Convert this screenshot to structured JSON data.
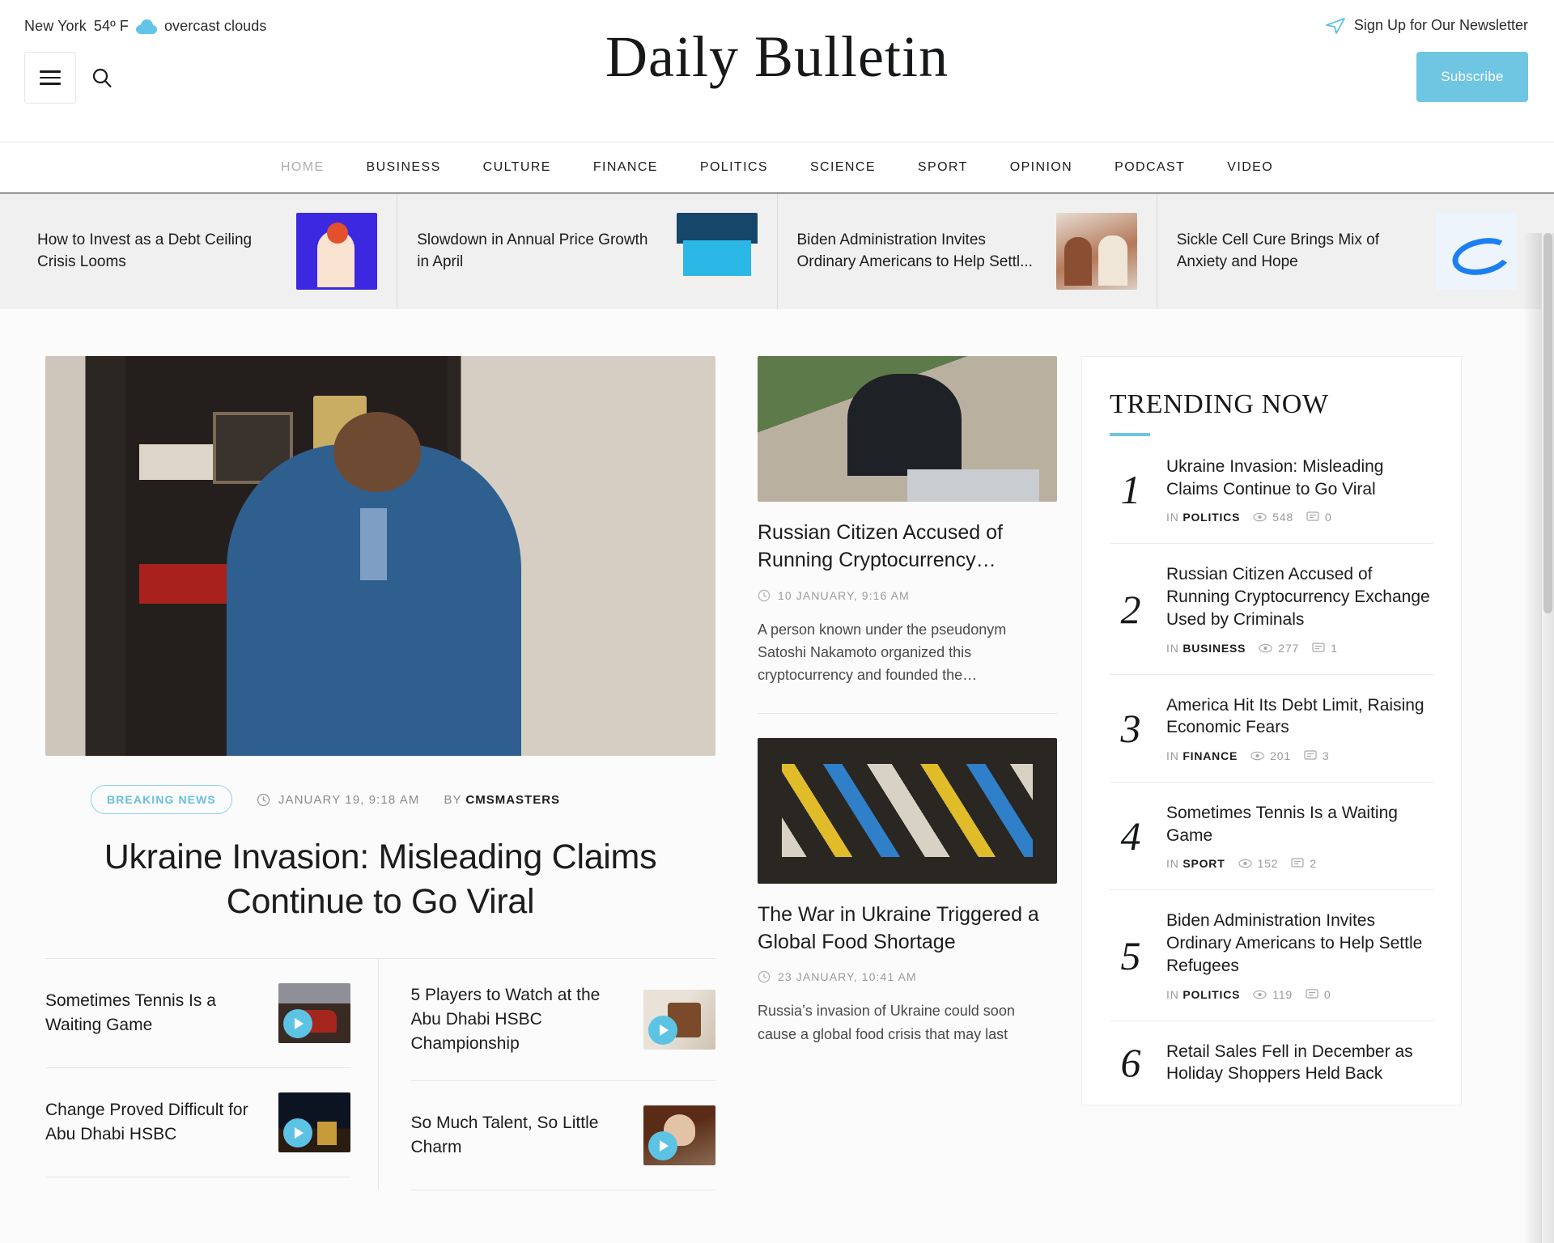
{
  "topbar": {
    "weather": {
      "city": "New York",
      "temp": "54º F",
      "condition": "overcast clouds",
      "icon": "cloud-icon"
    },
    "newsletter_label": "Sign Up for Our Newsletter",
    "newsletter_icon": "paper-plane-icon",
    "subscribe_label": "Subscribe",
    "menu_icon": "hamburger-menu-icon",
    "search_icon": "search-icon",
    "site_title_word1": "Daily",
    "site_title_word2": "Bulletin"
  },
  "nav": {
    "items": [
      {
        "label": "HOME",
        "active": true
      },
      {
        "label": "BUSINESS",
        "active": false
      },
      {
        "label": "CULTURE",
        "active": false
      },
      {
        "label": "FINANCE",
        "active": false
      },
      {
        "label": "POLITICS",
        "active": false
      },
      {
        "label": "SCIENCE",
        "active": false
      },
      {
        "label": "SPORT",
        "active": false
      },
      {
        "label": "OPINION",
        "active": false
      },
      {
        "label": "PODCAST",
        "active": false
      },
      {
        "label": "VIDEO",
        "active": false
      }
    ]
  },
  "ticker": {
    "items": [
      {
        "title": "How to Invest as a Debt Ceiling Crisis Looms",
        "art": "art-invest"
      },
      {
        "title": "Slowdown in Annual Price Growth in April",
        "art": "art-laptop"
      },
      {
        "title": "Biden Administration Invites Ordinary Americans to Help Settl...",
        "art": "art-women"
      },
      {
        "title": "Sickle Cell Cure Brings Mix of Anxiety and Hope",
        "art": "art-meta"
      }
    ]
  },
  "hero": {
    "badge": "BREAKING NEWS",
    "date": "JANUARY 19, 9:18 AM",
    "by_prefix": "BY",
    "author": "CMSMASTERS",
    "title": "Ukraine Invasion: Misleading Claims Continue to Go Viral",
    "clock_icon": "clock-icon"
  },
  "sub_articles": {
    "left": [
      {
        "title": "Sometimes Tennis Is a Waiting Game",
        "art": "th-car",
        "play_icon": "play-icon"
      },
      {
        "title": "Change Proved Difficult for Abu Dhabi HSBC",
        "art": "th-night",
        "play_icon": "play-icon"
      }
    ],
    "right": [
      {
        "title": "5 Players to Watch at the Abu Dhabi HSBC Championship",
        "art": "th-window",
        "play_icon": "play-icon"
      },
      {
        "title": "So Much Talent, So Little Charm",
        "art": "th-portrait",
        "play_icon": "play-icon"
      }
    ]
  },
  "mid_articles": [
    {
      "title": "Russian Citizen Accused of Running Cryptocurrency…",
      "date": "10 JANUARY, 9:16 AM",
      "excerpt": "A person known under the pseudonym Satoshi Nakamoto organized this cryptocurrency and founded the…",
      "art": "mimg-woman",
      "clock_icon": "clock-icon"
    },
    {
      "title": "The War in Ukraine Triggered a Global Food Shortage",
      "date": "23 JANUARY, 10:41 AM",
      "excerpt": "Russia’s invasion of Ukraine could soon cause a global food crisis that may last",
      "art": "mimg-protest",
      "clock_icon": "clock-icon"
    }
  ],
  "trending": {
    "heading": "TRENDING NOW",
    "in_label": "IN",
    "views_icon": "eye-icon",
    "comments_icon": "comment-icon",
    "items": [
      {
        "num": "1",
        "title": "Ukraine Invasion: Misleading Claims Continue to Go Viral",
        "category": "POLITICS",
        "views": "548",
        "comments": "0"
      },
      {
        "num": "2",
        "title": "Russian Citizen Accused of Running Cryptocurrency Exchange Used by Criminals",
        "category": "BUSINESS",
        "views": "277",
        "comments": "1"
      },
      {
        "num": "3",
        "title": "America Hit Its Debt Limit, Raising Economic Fears",
        "category": "FINANCE",
        "views": "201",
        "comments": "3"
      },
      {
        "num": "4",
        "title": "Sometimes Tennis Is a Waiting Game",
        "category": "SPORT",
        "views": "152",
        "comments": "2"
      },
      {
        "num": "5",
        "title": "Biden Administration Invites Ordinary Americans to Help Settle Refugees",
        "category": "POLITICS",
        "views": "119",
        "comments": "0"
      },
      {
        "num": "6",
        "title": "Retail Sales Fell in December as Holiday Shoppers Held Back",
        "category": "",
        "views": "",
        "comments": ""
      }
    ]
  },
  "colors": {
    "accent": "#6ec6e2",
    "text": "#1c1c1c",
    "muted": "#9a9a9a",
    "ticker_bg": "#f0f0f0"
  }
}
